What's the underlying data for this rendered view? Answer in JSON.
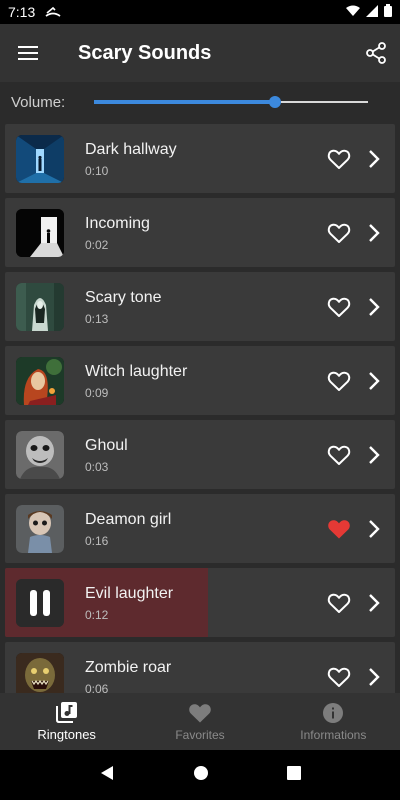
{
  "status": {
    "time": "7:13"
  },
  "app_bar": {
    "title": "Scary Sounds"
  },
  "volume": {
    "label": "Volume:",
    "level": 0.66
  },
  "colors": {
    "accent": "#3c89dd",
    "favorite_active": "#e53935",
    "playing_bg": "#5e2a2e"
  },
  "sounds": [
    {
      "name": "Dark hallway",
      "duration": "0:10",
      "favorite": false,
      "playing": false,
      "icon": "dark-hallway-thumbnail"
    },
    {
      "name": "Incoming",
      "duration": "0:02",
      "favorite": false,
      "playing": false,
      "icon": "incoming-thumbnail"
    },
    {
      "name": "Scary tone",
      "duration": "0:13",
      "favorite": false,
      "playing": false,
      "icon": "scary-tone-thumbnail"
    },
    {
      "name": "Witch laughter",
      "duration": "0:09",
      "favorite": false,
      "playing": false,
      "icon": "witch-laughter-thumbnail"
    },
    {
      "name": "Ghoul",
      "duration": "0:03",
      "favorite": false,
      "playing": false,
      "icon": "ghoul-thumbnail"
    },
    {
      "name": "Deamon girl",
      "duration": "0:16",
      "favorite": true,
      "playing": false,
      "icon": "deamon-girl-thumbnail"
    },
    {
      "name": "Evil laughter",
      "duration": "0:12",
      "favorite": false,
      "playing": true,
      "progress": 0.52,
      "icon": "pause-icon"
    },
    {
      "name": "Zombie roar",
      "duration": "0:06",
      "favorite": false,
      "playing": false,
      "icon": "zombie-roar-thumbnail"
    }
  ],
  "bottom_nav": [
    {
      "label": "Ringtones",
      "icon": "music-library-icon",
      "active": true
    },
    {
      "label": "Favorites",
      "icon": "heart-icon",
      "active": false
    },
    {
      "label": "Informations",
      "icon": "info-icon",
      "active": false
    }
  ]
}
